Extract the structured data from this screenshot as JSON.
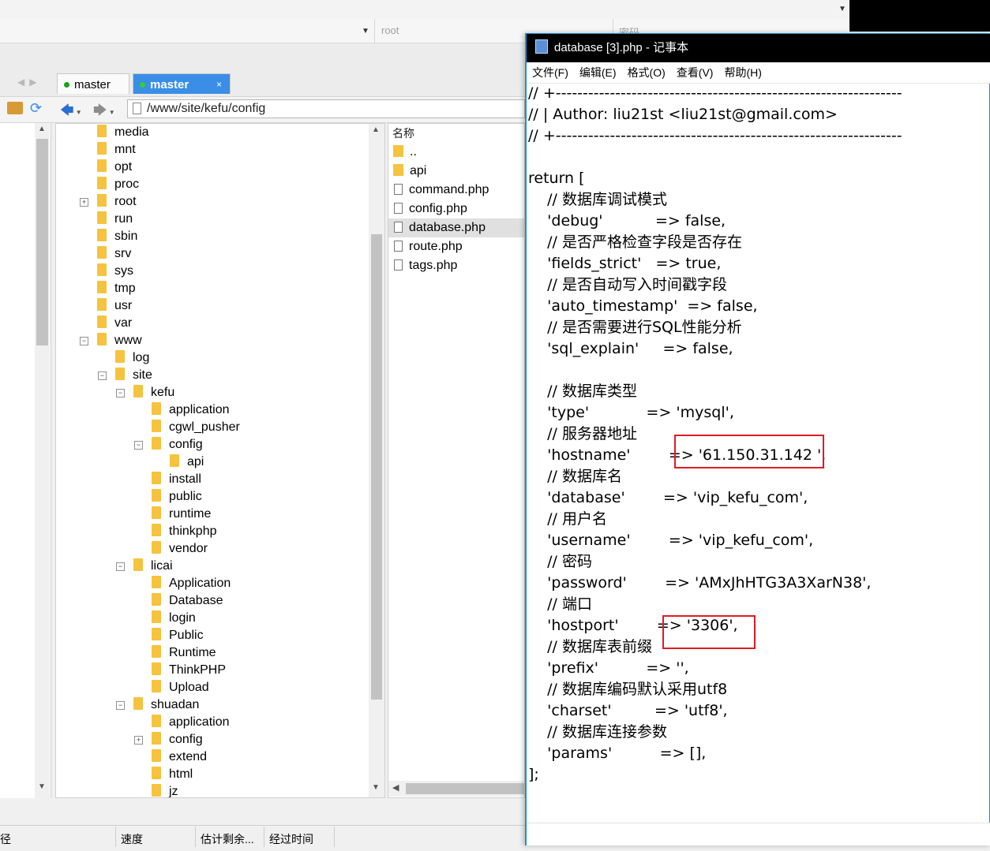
{
  "connection": {
    "user_placeholder": "root",
    "password_placeholder": "密码"
  },
  "tabs": [
    {
      "label": "master",
      "active": false
    },
    {
      "label": "master",
      "active": true
    }
  ],
  "path": {
    "current": "/www/site/kefu/config"
  },
  "tree": [
    {
      "label": "media",
      "depth": 0
    },
    {
      "label": "mnt",
      "depth": 0
    },
    {
      "label": "opt",
      "depth": 0
    },
    {
      "label": "proc",
      "depth": 0
    },
    {
      "label": "root",
      "depth": 0,
      "expander": "+"
    },
    {
      "label": "run",
      "depth": 0
    },
    {
      "label": "sbin",
      "depth": 0
    },
    {
      "label": "srv",
      "depth": 0
    },
    {
      "label": "sys",
      "depth": 0
    },
    {
      "label": "tmp",
      "depth": 0
    },
    {
      "label": "usr",
      "depth": 0
    },
    {
      "label": "var",
      "depth": 0
    },
    {
      "label": "www",
      "depth": 0,
      "expander": "-"
    },
    {
      "label": "log",
      "depth": 1
    },
    {
      "label": "site",
      "depth": 1,
      "expander": "-"
    },
    {
      "label": "kefu",
      "depth": 2,
      "expander": "-"
    },
    {
      "label": "application",
      "depth": 3
    },
    {
      "label": "cgwl_pusher",
      "depth": 3
    },
    {
      "label": "config",
      "depth": 3,
      "expander": "-"
    },
    {
      "label": "api",
      "depth": 4
    },
    {
      "label": "install",
      "depth": 3
    },
    {
      "label": "public",
      "depth": 3
    },
    {
      "label": "runtime",
      "depth": 3
    },
    {
      "label": "thinkphp",
      "depth": 3
    },
    {
      "label": "vendor",
      "depth": 3
    },
    {
      "label": "licai",
      "depth": 2,
      "expander": "-"
    },
    {
      "label": "Application",
      "depth": 3
    },
    {
      "label": "Database",
      "depth": 3
    },
    {
      "label": "login",
      "depth": 3
    },
    {
      "label": "Public",
      "depth": 3
    },
    {
      "label": "Runtime",
      "depth": 3
    },
    {
      "label": "ThinkPHP",
      "depth": 3
    },
    {
      "label": "Upload",
      "depth": 3
    },
    {
      "label": "shuadan",
      "depth": 2,
      "expander": "-"
    },
    {
      "label": "application",
      "depth": 3
    },
    {
      "label": "config",
      "depth": 3,
      "expander": "+"
    },
    {
      "label": "extend",
      "depth": 3
    },
    {
      "label": "html",
      "depth": 3
    },
    {
      "label": "jz",
      "depth": 3
    }
  ],
  "files": {
    "header": "名称",
    "items": [
      {
        "name": "..",
        "kind": "folder"
      },
      {
        "name": "api",
        "kind": "folder"
      },
      {
        "name": "command.php",
        "kind": "php"
      },
      {
        "name": "config.php",
        "kind": "php"
      },
      {
        "name": "database.php",
        "kind": "php",
        "selected": true
      },
      {
        "name": "route.php",
        "kind": "php"
      },
      {
        "name": "tags.php",
        "kind": "php"
      }
    ]
  },
  "status": {
    "col1": "径",
    "col2": "速度",
    "col3": "估计剩余...",
    "col4": "经过时间"
  },
  "notepad": {
    "title": "database [3].php - 记事本",
    "menu": [
      "文件(F)",
      "编辑(E)",
      "格式(O)",
      "查看(V)",
      "帮助(H)"
    ],
    "lines": [
      "// +----------------------------------------------------------------",
      "// | Author: liu21st <liu21st@gmail.com>",
      "// +----------------------------------------------------------------",
      "",
      "return [",
      "    // 数据库调试模式",
      "    'debug'           => false,",
      "    // 是否严格检查字段是否存在",
      "    'fields_strict'   => true,",
      "    // 是否自动写入时间戳字段",
      "    'auto_timestamp'  => false,",
      "    // 是否需要进行SQL性能分析",
      "    'sql_explain'     => false,",
      "",
      "    // 数据库类型",
      "    'type'            => 'mysql',",
      "    // 服务器地址",
      "    'hostname'        => '61.150.31.142 ',",
      "    // 数据库名",
      "    'database'        => 'vip_kefu_com',",
      "    // 用户名",
      "    'username'        => 'vip_kefu_com',",
      "    // 密码",
      "    'password'        => 'AMxJhHTG3A3XarN38',",
      "    // 端口",
      "    'hostport'        => '3306',",
      "    // 数据库表前缀",
      "    'prefix'          => '',",
      "    // 数据库编码默认采用utf8",
      "    'charset'         => 'utf8',",
      "    // 数据库连接参数",
      "    'params'          => [],",
      "];"
    ]
  },
  "colors": {
    "accent": "#3a8ee6",
    "highlight_box": "#e01b24",
    "folder": "#f5c33f"
  }
}
